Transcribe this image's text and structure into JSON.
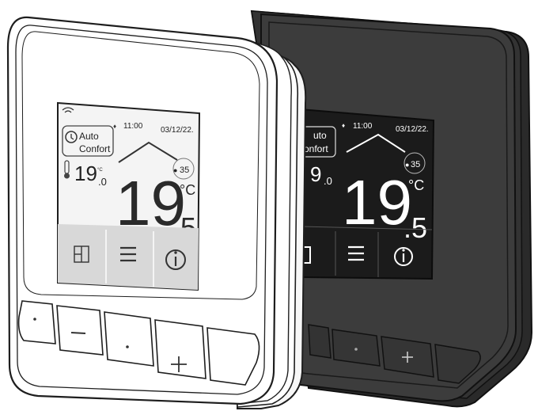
{
  "white_device": {
    "status_time": "11:00",
    "status_date": "03/12/22.",
    "mode_line1": "Auto",
    "mode_line2": "Confort",
    "ambient_int": "19",
    "ambient_dec": ".0",
    "ambient_unit": "°C",
    "humidity": "35",
    "setpoint_int": "19",
    "setpoint_dec": ".5",
    "setpoint_unit": "°C",
    "nav": [
      "window-icon",
      "menu-icon",
      "info-icon"
    ],
    "buttons": [
      "dot",
      "minus",
      "dot",
      "plus",
      "blank"
    ]
  },
  "dark_device": {
    "status_time": "11:00",
    "status_date": "03/12/22.",
    "mode_line1": "uto",
    "mode_line2": "onfort",
    "ambient_int": "9",
    "ambient_dec": ".0",
    "ambient_unit": "°C",
    "humidity": "35",
    "setpoint_int": "19",
    "setpoint_dec": ".5",
    "setpoint_unit": "°C"
  },
  "colors": {
    "white_body": "#ffffff",
    "dark_body": "#3a3a3a",
    "screen_light": "#f4f4f4",
    "screen_dark": "#1c1c1c",
    "nav_bar_light": "#d6d6d6",
    "outline": "#1e1e1e"
  }
}
